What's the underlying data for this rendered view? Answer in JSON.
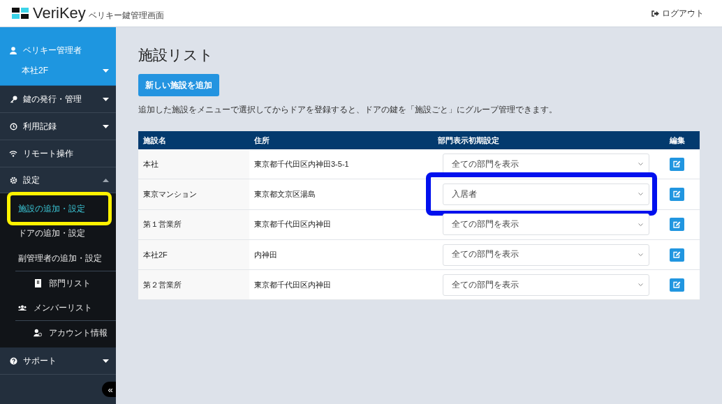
{
  "header": {
    "logo": "VeriKey",
    "subtitle": "ベリキー鍵管理画面",
    "logout": "ログアウト"
  },
  "sidebar": {
    "user": "ベリキー管理者",
    "facility": "本社2F",
    "menu": [
      {
        "label": "鍵の発行・管理",
        "expanded": false
      },
      {
        "label": "利用記録",
        "expanded": false
      },
      {
        "label": "リモート操作"
      },
      {
        "label": "設定",
        "expanded": true,
        "children": [
          {
            "label": "施設の追加・設定",
            "selected": true,
            "highlighted": true
          },
          {
            "label": "ドアの追加・設定",
            "selected": false,
            "highlighted": false
          },
          {
            "label": "副管理者の追加・設定",
            "selected": false,
            "highlighted": false
          },
          {
            "label": "部門リスト",
            "selected": false,
            "highlighted": false
          },
          {
            "label": "メンバーリスト",
            "selected": false,
            "highlighted": false
          },
          {
            "label": "アカウント情報",
            "selected": false,
            "highlighted": false
          }
        ]
      },
      {
        "label": "サポート",
        "expanded": false
      }
    ],
    "collapse": "«"
  },
  "main": {
    "title": "施設リスト",
    "add_button": "新しい施設を追加",
    "description": "追加した施設をメニューで選択してからドアを登録すると、ドアの鍵を「施設ごと」にグループ管理できます。",
    "table": {
      "columns": [
        "施設名",
        "住所",
        "部門表示初期設定",
        "編集"
      ],
      "rows": [
        {
          "name": "本社",
          "address": "東京都千代田区内神田3-5-1",
          "display": "全ての部門を表示",
          "highlighted": false
        },
        {
          "name": "東京マンション",
          "address": "東京都文京区湯島",
          "display": "入居者",
          "highlighted": true
        },
        {
          "name": "第１営業所",
          "address": "東京都千代田区内神田",
          "display": "全ての部門を表示",
          "highlighted": false
        },
        {
          "name": "本社2F",
          "address": "内神田",
          "display": "全ての部門を表示",
          "highlighted": false
        },
        {
          "name": "第２営業所",
          "address": "東京都千代田区内神田",
          "display": "全ての部門を表示",
          "highlighted": false
        }
      ]
    }
  }
}
